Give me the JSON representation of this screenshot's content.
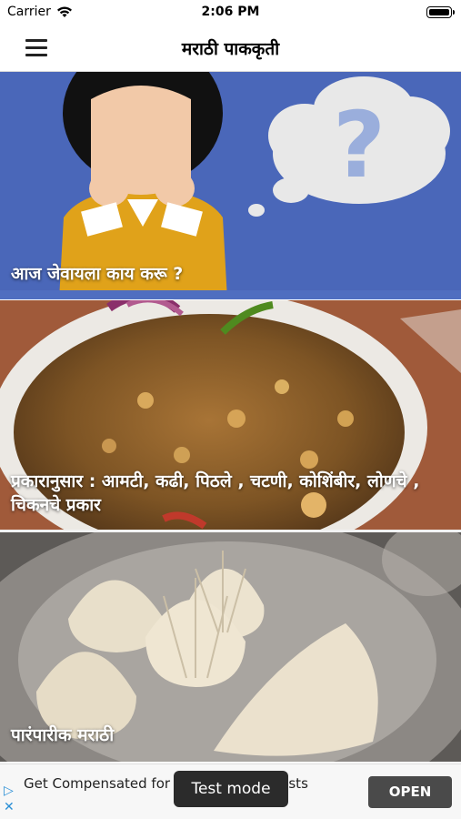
{
  "status_bar": {
    "carrier": "Carrier",
    "time": "2:06 PM",
    "wifi_icon": "wifi-icon",
    "battery_icon": "battery-icon"
  },
  "nav": {
    "title": "मराठी पाककृती",
    "menu_icon": "hamburger-menu-icon"
  },
  "cards": [
    {
      "label": "आज जेवायला काय करू ?",
      "image": "thinking-person-illustration"
    },
    {
      "label": "प्रकारानुसार : आमटी, कढी, पिठले , चटणी, कोशिंबीर, लोणचे , चिकनचे प्रकार",
      "image": "curry-bowl-photo"
    },
    {
      "label": "पारंपारीक मराठी",
      "image": "modak-plate-photo"
    }
  ],
  "ad": {
    "text": "Get Compensated for Out-of-Pocket Costs",
    "mode_label": "Test mode",
    "open_label": "OPEN",
    "ad_icon": "ad-choices-icon"
  },
  "colors": {
    "card1_bg": "#4a67b9",
    "accent_yellow": "#e0a21a",
    "ad_button": "#4a4a4a"
  }
}
